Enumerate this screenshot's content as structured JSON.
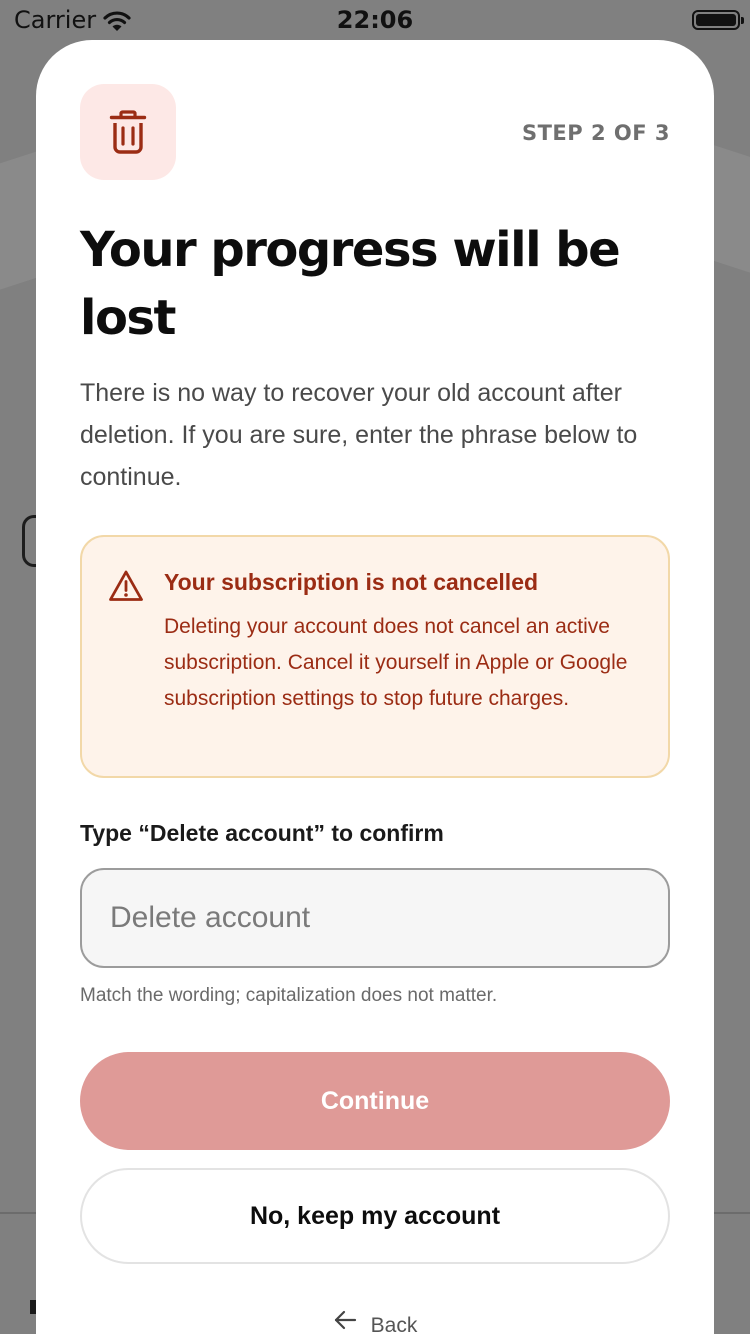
{
  "status_bar": {
    "carrier": "Carrier",
    "time": "22:06",
    "icons": [
      "wifi-icon",
      "battery-icon"
    ]
  },
  "dialog": {
    "icon": "trash-icon",
    "step": "STEP 2 OF 3",
    "title": "Your progress will be lost",
    "intro": "There is no way to recover your old account after deletion. If you are sure, enter the phrase below to continue.",
    "warning": {
      "icon": "warning-triangle-icon",
      "title": "Your subscription is not cancelled",
      "body": "Deleting your account does not cancel an active subscription. Cancel it yourself in Apple or Google subscription settings to stop future charges."
    },
    "confirm": {
      "label": "Type “Delete account” to confirm",
      "value": "",
      "placeholder": "Delete account",
      "hint": "Match the wording; capitalization does not matter."
    },
    "buttons": {
      "continue": "Continue",
      "keep": "No, keep my account",
      "back": "Back"
    }
  },
  "colors": {
    "accent": "#df9a97",
    "icon_red": "#9b2c14",
    "warning_bg": "#fef3ea",
    "warning_border": "#f2d8a8",
    "icon_tile_bg": "#fde8e6"
  }
}
